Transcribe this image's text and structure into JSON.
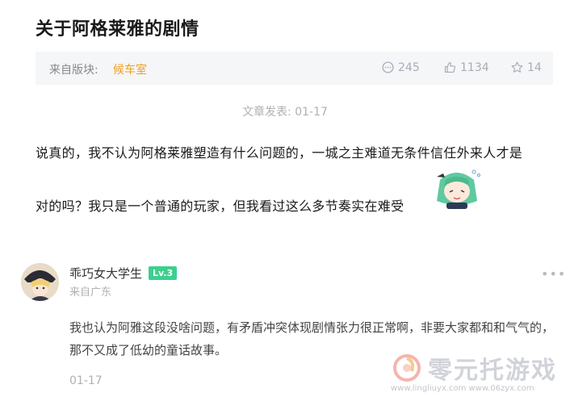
{
  "post": {
    "title": "关于阿格莱雅的剧情",
    "board_label": "来自版块:",
    "board_name": "候车室",
    "comments": "245",
    "likes": "1134",
    "favorites": "14",
    "date": "文章发表: 01-17",
    "body_line1": "说真的，我不认为阿格莱雅塑造有什么问题的，一城之主难道无条件信任外来人才是",
    "body_line2": "对的吗？我只是一个普通的玩家，但我看过这么多节奏实在难受"
  },
  "comment": {
    "username": "乖巧女大学生",
    "level": "Lv.3",
    "location": "来自广东",
    "more": "•••",
    "text": "我也认为阿雅这段没啥问题，有矛盾冲突体现剧情张力很正常啊，非要大家都和和气气的，那不又成了低幼的童话故事。",
    "date": "01-17"
  },
  "watermark": {
    "brand": "零元托游戏",
    "sites": "www.lingliuyx.com   www.06zyx.com"
  },
  "colors": {
    "accent_orange": "#f0a020",
    "level_green": "#3ecf8e",
    "meta_bg": "#f5f6f8"
  }
}
